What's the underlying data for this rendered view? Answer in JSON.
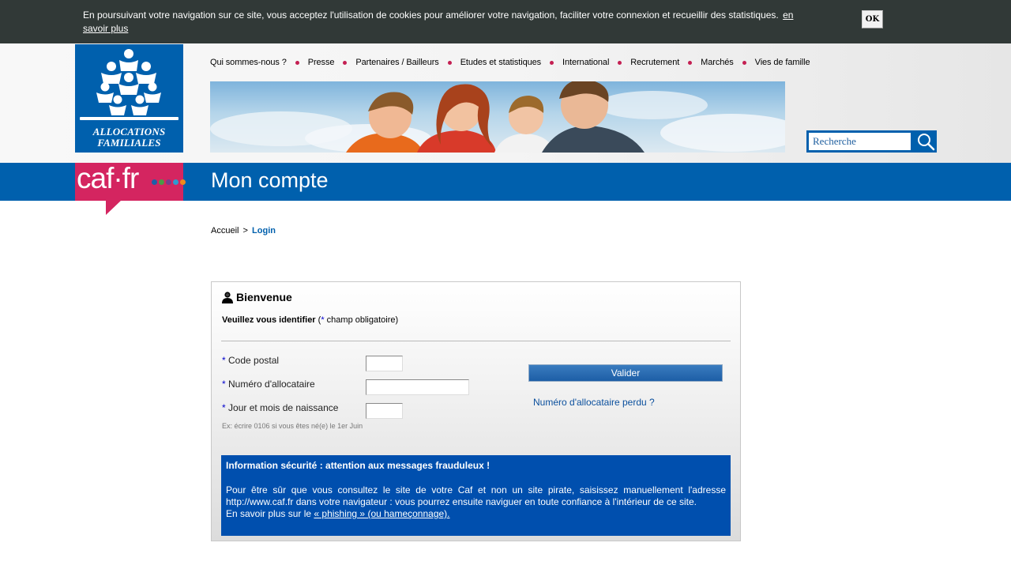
{
  "cookie": {
    "text": "En poursuivant votre navigation sur ce site, vous acceptez l'utilisation de cookies pour améliorer votre navigation, faciliter votre connexion et recueillir des statistiques.",
    "link": "en savoir plus",
    "ok": "OK"
  },
  "logo": {
    "line1": "ALLOCATIONS",
    "line2": "FAMILIALES"
  },
  "nav": {
    "items": [
      "Qui sommes-nous ?",
      "Presse",
      "Partenaires / Bailleurs",
      "Etudes et statistiques",
      "International",
      "Recrutement",
      "Marchés",
      "Vies de famille"
    ]
  },
  "search": {
    "placeholder": "Recherche",
    "icon": "magnifier-icon"
  },
  "brand": {
    "name": "caf·fr",
    "dot_colors": [
      "#1d5fa8",
      "#4a9b45",
      "#7a3b8c",
      "#2e9ad0",
      "#f08a1c"
    ]
  },
  "page": {
    "title": "Mon compte"
  },
  "breadcrumb": {
    "home": "Accueil",
    "separator": ">",
    "current": "Login"
  },
  "login": {
    "title": "Bienvenue",
    "title_icon": "user-icon",
    "subtitle_bold": "Veuillez vous identifier",
    "subtitle_open": " (",
    "subtitle_star": "*",
    "subtitle_rest": " champ obligatoire)",
    "required_mark": "*",
    "fields": {
      "postal_code": {
        "label": "Code postal",
        "value": ""
      },
      "allocataire": {
        "label": "Numéro d'allocataire",
        "value": ""
      },
      "birth": {
        "label": "Jour et mois de naissance",
        "value": ""
      }
    },
    "hint": "Ex: écrire 0106 si vous êtes né(e) le 1er Juin",
    "submit": "Valider",
    "lost_link": "Numéro d'allocataire perdu ?"
  },
  "security": {
    "title": "Information sécurité : attention aux messages frauduleux !",
    "body": "Pour être sûr que vous consultez le site de votre Caf et non un site pirate, saisissez manuellement l'adresse http://www.caf.fr dans votre navigateur : vous pourrez ensuite naviguer en toute confiance à l'intérieur de ce site.",
    "more_prefix": "En savoir plus sur le ",
    "more_link": "« phishing » (ou hameçonnage)."
  },
  "colors": {
    "brand_blue": "#0060ad",
    "brand_pink": "#d42560",
    "nav_bullet": "#c41f52",
    "security_blue": "#004fae",
    "cookie_bar": "#313937"
  }
}
